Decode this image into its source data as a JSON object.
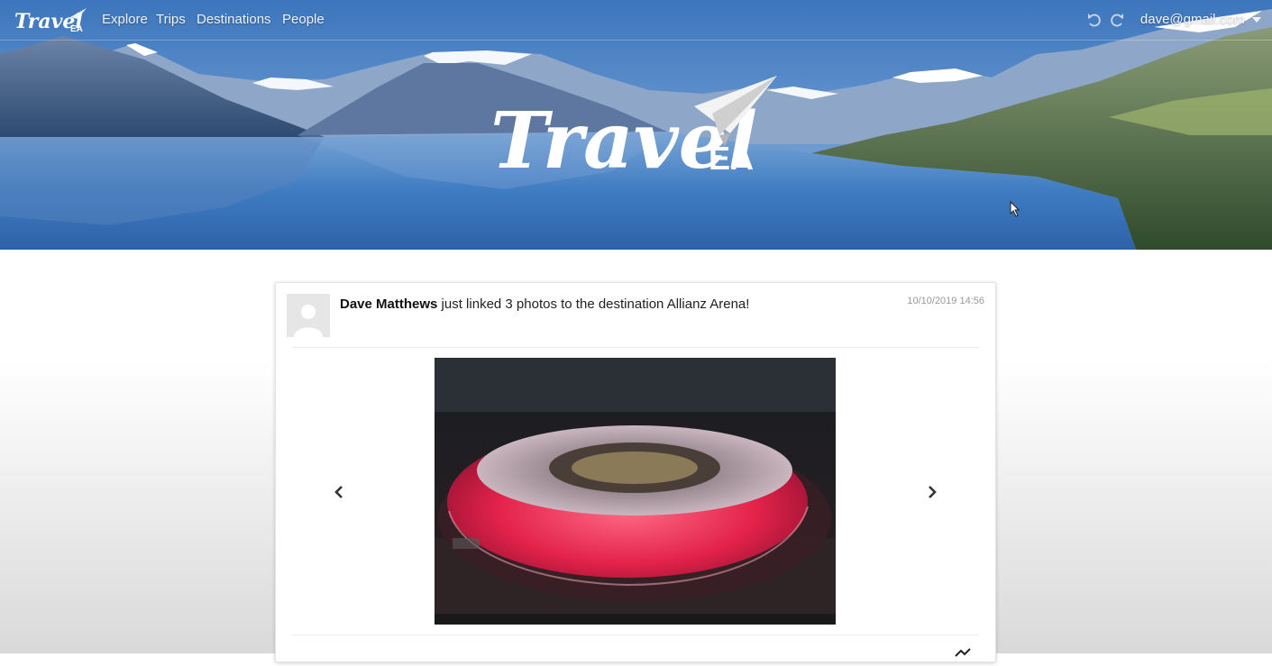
{
  "navbar": {
    "brand": {
      "script": "Travel",
      "suffix": "EA"
    },
    "links": [
      {
        "label": "Explore"
      },
      {
        "label": "Trips"
      },
      {
        "label": "Destinations"
      },
      {
        "label": "People"
      }
    ],
    "undo_icon": "undo-icon",
    "redo_icon": "redo-icon",
    "user_email": "dave@gmail.com"
  },
  "hero": {
    "logo_script": "Travel",
    "logo_suffix": "EA",
    "logo_icon": "paper-plane-icon"
  },
  "feed": {
    "items": [
      {
        "author": "Dave Matthews",
        "message": "just linked 3 photos to the destination Allianz Arena!",
        "timestamp": "10/10/2019 14:56",
        "photo_subject": "Allianz Arena at night",
        "prev_icon": "chevron-left-icon",
        "next_icon": "chevron-right-icon"
      }
    ]
  },
  "colors": {
    "sky": "#4f86c9",
    "lake": "#3e79bf",
    "stadium_red": "#e0264a",
    "text_dark": "#222222",
    "timestamp": "#999999"
  }
}
